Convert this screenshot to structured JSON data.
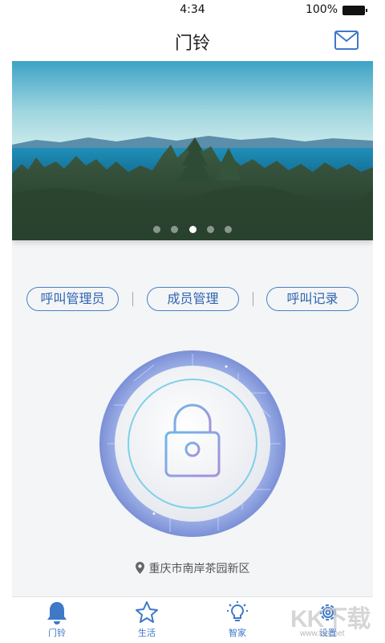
{
  "status_bar": {
    "time": "4:34",
    "battery": "100%"
  },
  "header": {
    "title": "门铃",
    "mail_icon": "mail-icon"
  },
  "banner": {
    "image": "coastline-forest-photo",
    "dots_count": 5,
    "active_dot": 3
  },
  "actions": [
    {
      "label": "呼叫管理员"
    },
    {
      "label": "成员管理"
    },
    {
      "label": "呼叫记录"
    }
  ],
  "lock": {
    "icon": "lock-icon"
  },
  "location": {
    "text": "重庆市南岸茶园新区",
    "icon": "location-pin-icon"
  },
  "tabbar": {
    "items": [
      {
        "label": "门铃",
        "icon": "bell-icon",
        "active": true
      },
      {
        "label": "生活",
        "icon": "star-icon",
        "active": false
      },
      {
        "label": "智家",
        "icon": "bulb-icon",
        "active": false
      },
      {
        "label": "设置",
        "icon": "gear-icon",
        "active": false
      }
    ]
  },
  "watermark": {
    "text": "KK下载",
    "url": "www.kkx.net"
  },
  "colors": {
    "accent": "#3f78c8",
    "pill_border": "#4a7fc4",
    "background": "#f3f5f7"
  }
}
